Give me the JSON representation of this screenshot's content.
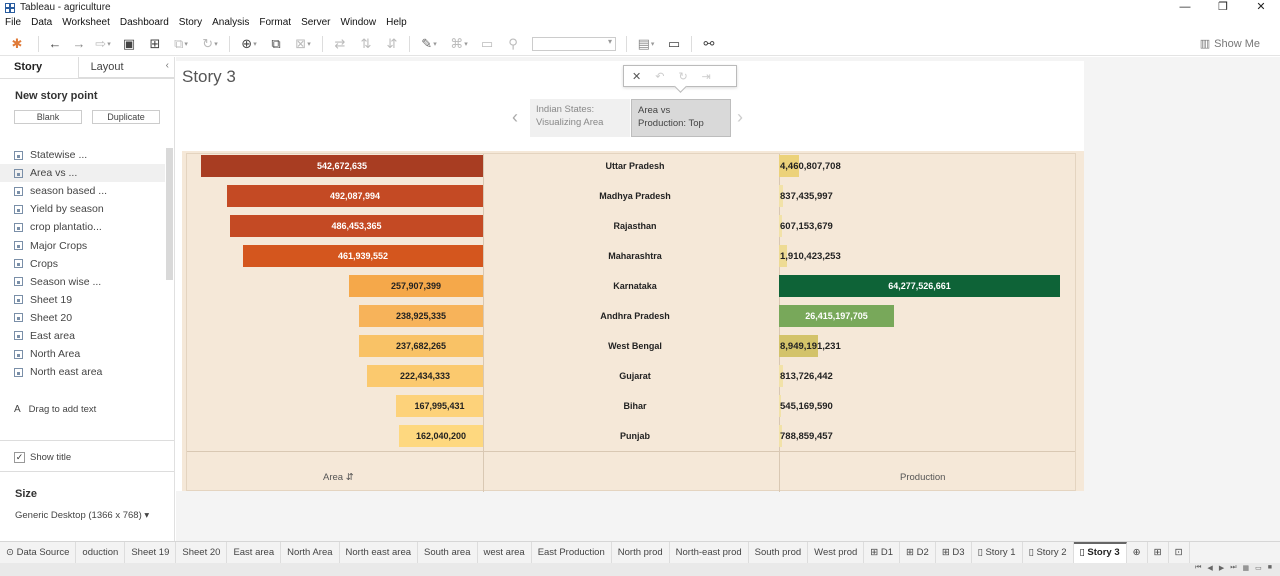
{
  "window": {
    "title": "Tableau - agriculture",
    "minimize": "—",
    "restore": "❐",
    "close": "✕"
  },
  "menu": [
    "File",
    "Data",
    "Worksheet",
    "Dashboard",
    "Story",
    "Analysis",
    "Format",
    "Server",
    "Window",
    "Help"
  ],
  "toolbar": {
    "show_me": "Show Me"
  },
  "left_pane": {
    "tab_story": "Story",
    "tab_layout": "Layout",
    "collapse": "‹",
    "new_story_point": "New story point",
    "blank_button": "Blank",
    "duplicate_button": "Duplicate",
    "sheets": [
      "Statewise ...",
      "Area vs ...",
      "season based ...",
      "Yield by season",
      "crop plantatio...",
      "Major Crops",
      "Crops",
      "Season wise ...",
      "Sheet 19",
      "Sheet 20",
      "East area",
      "North Area",
      "North east area"
    ],
    "drag_text": "Drag to add text",
    "drag_icon": "A",
    "show_title": "Show title",
    "show_title_checked": "✓",
    "size_label": "Size",
    "size_value": "Generic Desktop (1366 x 768) ▾"
  },
  "story": {
    "title": "Story 3",
    "points": [
      {
        "line1": "Indian States:",
        "line2": "Visualizing Area"
      },
      {
        "line1": "Area vs",
        "line2": "Production: Top"
      }
    ],
    "prev": "‹",
    "next": "›",
    "nav_popup": {
      "close": "✕",
      "undo": "↶",
      "revert": "↻",
      "update": "⇥"
    }
  },
  "chart_data": {
    "type": "bar",
    "categories": [
      "Uttar Pradesh",
      "Madhya Pradesh",
      "Rajasthan",
      "Maharashtra",
      "Karnataka",
      "Andhra Pradesh",
      "West Bengal",
      "Gujarat",
      "Bihar",
      "Punjab"
    ],
    "series": [
      {
        "name": "Area",
        "values": [
          542672635,
          492087994,
          486453365,
          461939552,
          257907399,
          238925335,
          237682265,
          222434333,
          167995431,
          162040200
        ],
        "labels": [
          "542,672,635",
          "492,087,994",
          "486,453,365",
          "461,939,552",
          "257,907,399",
          "238,925,335",
          "237,682,265",
          "222,434,333",
          "167,995,431",
          "162,040,200"
        ],
        "colors": [
          "#a83d22",
          "#c44a24",
          "#c44a24",
          "#d4561e",
          "#f5a84a",
          "#f7b35a",
          "#f9c266",
          "#fbc96e",
          "#fdd27a",
          "#fed87f"
        ]
      },
      {
        "name": "Production",
        "values": [
          4460807708,
          837435997,
          607153679,
          1910423253,
          64277526661,
          26415197705,
          8949191231,
          813726442,
          545169590,
          788859457
        ],
        "labels": [
          "4,460,807,708",
          "837,435,997",
          "607,153,679",
          "1,910,423,253",
          "64,277,526,661",
          "26,415,197,705",
          "8,949,191,231",
          "813,726,442",
          "545,169,590",
          "788,859,457"
        ],
        "colors": [
          "#ecd27a",
          "#f2e2a8",
          "#f2e2a8",
          "#eedb94",
          "#0e6337",
          "#78a85a",
          "#d3c36a",
          "#f2e2a8",
          "#f2e2a8",
          "#f2e2a8"
        ]
      }
    ],
    "xlabel_area": "Area",
    "xlabel_production": "Production",
    "sort_icon": "⇵"
  },
  "bottom_tabs": [
    "Data Source",
    "oduction",
    "Sheet 19",
    "Sheet 20",
    "East area",
    "North Area",
    "North east area",
    "South area",
    "west area",
    "East Production",
    "North prod",
    "North-east prod",
    "South prod",
    "West prod",
    "D1",
    "D2",
    "D3",
    "Story 1",
    "Story 2",
    "Story 3"
  ],
  "active_tab": "Story 3"
}
